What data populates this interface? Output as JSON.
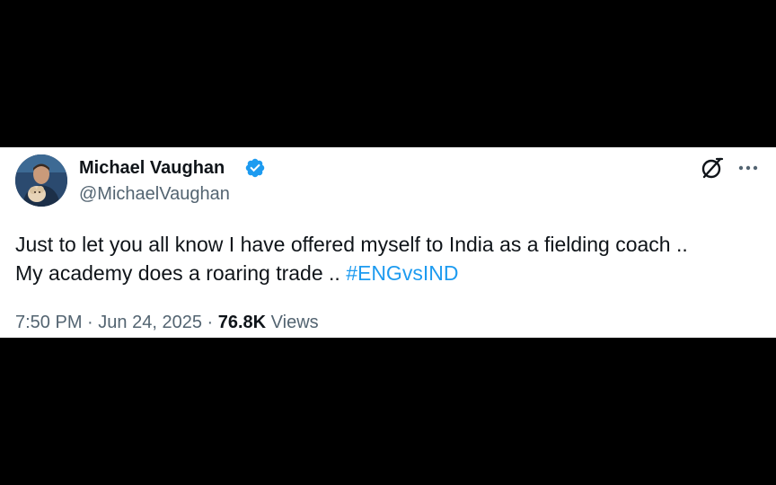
{
  "tweet": {
    "author": {
      "display_name": "Michael Vaughan",
      "handle": "@MichaelVaughan",
      "verified": true
    },
    "text_line_1": "Just to let you all know I have offered myself to India as a fielding coach ..",
    "text_line_2_prefix": "My academy does a roaring trade .. ",
    "hashtag": "#ENGvsIND",
    "time": "7:50 PM",
    "separator": "·",
    "date": "Jun 24, 2025",
    "views_count": "76.8K",
    "views_label": "Views"
  },
  "icons": {
    "verified": "verified-badge-icon",
    "grok": "grok-icon",
    "more": "more-options-icon"
  },
  "colors": {
    "background": "#000000",
    "card": "#ffffff",
    "text_primary": "#0f1419",
    "text_secondary": "#536471",
    "accent": "#1d9bf0"
  }
}
